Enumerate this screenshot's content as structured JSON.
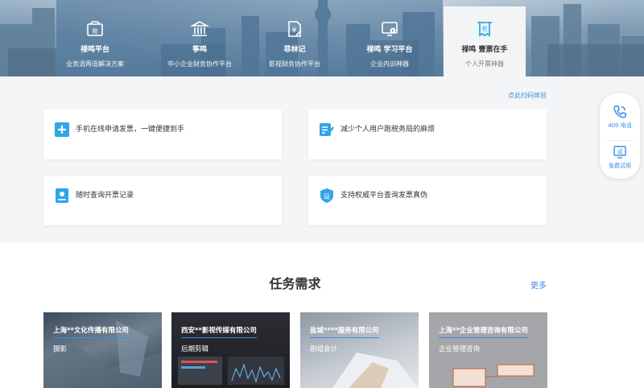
{
  "products": [
    {
      "name": "禄鸣平台",
      "desc": "业务流再造解决方案",
      "icon": "tax-folder-icon"
    },
    {
      "name": "筝鸣",
      "desc": "中小企业财务协作平台",
      "icon": "bank-building-icon"
    },
    {
      "name": "菲林记",
      "desc": "影视财务协作平台",
      "icon": "yen-document-icon"
    },
    {
      "name": "禄鸣 学习平台",
      "desc": "企业内训神器",
      "icon": "monitor-play-icon"
    },
    {
      "name": "禄鸣 壹票在手",
      "desc": "个人开票神器",
      "icon": "invoice-icon"
    }
  ],
  "scan_link": "点此扫码体验",
  "features": [
    {
      "text": "手机在线申请发票，一键便捷到手",
      "icon": "plus-icon"
    },
    {
      "text": "减少个人用户跑税务局的麻烦",
      "icon": "edit-list-icon"
    },
    {
      "text": "随时查询开票记录",
      "icon": "record-icon"
    },
    {
      "text": "支持权威平台查询发票真伪",
      "icon": "verify-shield-icon"
    }
  ],
  "tasks": {
    "title": "任务需求",
    "more": "更多",
    "items": [
      {
        "company": "上海**文化传播有限公司",
        "category": "摄影"
      },
      {
        "company": "西安**影视传媒有限公司",
        "category": "后期剪辑"
      },
      {
        "company": "盐城****服务有限公司",
        "category": "剧组会计"
      },
      {
        "company": "上海**企业管理咨询有限公司",
        "category": "企业管理咨询"
      }
    ]
  },
  "side": {
    "phone_label": "400 电话",
    "trial_label": "免费试用",
    "trial_icon_text": "试"
  },
  "colors": {
    "accent": "#3a8ee6",
    "icon_blue": "#2fa6e8"
  }
}
